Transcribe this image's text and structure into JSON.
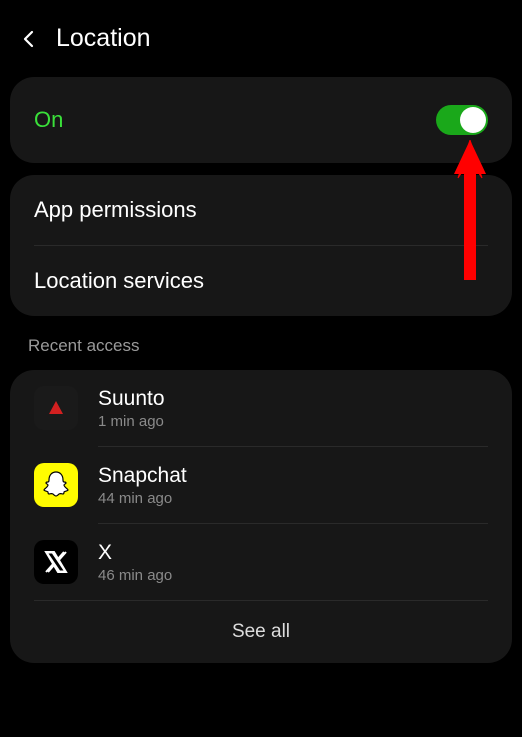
{
  "header": {
    "title": "Location"
  },
  "toggle": {
    "label": "On",
    "state": true,
    "label_color": "#3ae03a",
    "track_color": "#1aa81a"
  },
  "settings": {
    "items": [
      {
        "label": "App permissions"
      },
      {
        "label": "Location services"
      }
    ]
  },
  "recent": {
    "section_label": "Recent access",
    "apps": [
      {
        "name": "Suunto",
        "time": "1 min ago",
        "icon": "suunto"
      },
      {
        "name": "Snapchat",
        "time": "44 min ago",
        "icon": "snapchat"
      },
      {
        "name": "X",
        "time": "46 min ago",
        "icon": "x"
      }
    ],
    "see_all_label": "See all"
  },
  "annotation": {
    "arrow_color": "#ff0000"
  }
}
